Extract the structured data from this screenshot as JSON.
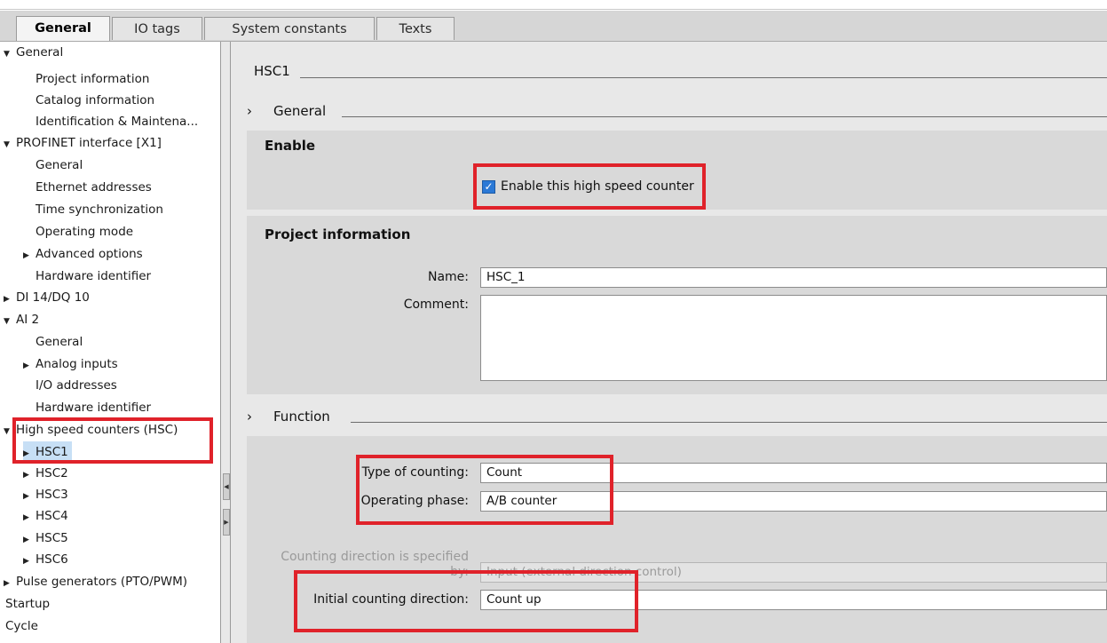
{
  "tabs": [
    {
      "label": "General"
    },
    {
      "label": "IO tags"
    },
    {
      "label": "System constants"
    },
    {
      "label": "Texts"
    }
  ],
  "tree": [
    {
      "label": "General",
      "caret": "▼"
    },
    {
      "label": "Project information"
    },
    {
      "label": "Catalog information"
    },
    {
      "label": "Identification & Maintena..."
    },
    {
      "label": "PROFINET interface [X1]",
      "caret": "▼"
    },
    {
      "label": "General"
    },
    {
      "label": "Ethernet addresses"
    },
    {
      "label": "Time synchronization"
    },
    {
      "label": "Operating mode"
    },
    {
      "label": "Advanced options",
      "caret": "▶"
    },
    {
      "label": "Hardware identifier"
    },
    {
      "label": "DI 14/DQ 10",
      "caret": "▶"
    },
    {
      "label": "AI 2",
      "caret": "▼"
    },
    {
      "label": "General"
    },
    {
      "label": "Analog inputs",
      "caret": "▶"
    },
    {
      "label": "I/O addresses"
    },
    {
      "label": "Hardware identifier"
    },
    {
      "label": "High speed counters (HSC)",
      "caret": "▼"
    },
    {
      "label": "HSC1",
      "caret": "▶"
    },
    {
      "label": "HSC2",
      "caret": "▶"
    },
    {
      "label": "HSC3",
      "caret": "▶"
    },
    {
      "label": "HSC4",
      "caret": "▶"
    },
    {
      "label": "HSC5",
      "caret": "▶"
    },
    {
      "label": "HSC6",
      "caret": "▶"
    },
    {
      "label": "Pulse generators (PTO/PWM)",
      "caret": "▶"
    },
    {
      "label": "Startup"
    },
    {
      "label": "Cycle"
    }
  ],
  "main": {
    "title": "HSC1",
    "general_section": {
      "chevron": "›",
      "label": "General"
    },
    "enable_panel": {
      "title": "Enable",
      "checkbox_label": "Enable this high speed counter",
      "checked": true
    },
    "project_panel": {
      "title": "Project information",
      "name_label": "Name:",
      "name_value": "HSC_1",
      "comment_label": "Comment:",
      "comment_value": ""
    },
    "function_section": {
      "chevron": "›",
      "label": "Function"
    },
    "function_panel": {
      "type_label": "Type of counting:",
      "type_value": "Count",
      "phase_label": "Operating phase:",
      "phase_value": "A/B counter",
      "direction_spec_label_1": "Counting direction is specified",
      "direction_spec_label_2": "by:",
      "direction_spec_value": "Input (external direction control)",
      "initial_dir_label": "Initial counting direction:",
      "initial_dir_value": "Count up"
    }
  },
  "colors": {
    "highlight": "#e0222a",
    "checkbox": "#2b79d6",
    "panel": "#d9d9d9",
    "background": "#e8e8e8"
  }
}
